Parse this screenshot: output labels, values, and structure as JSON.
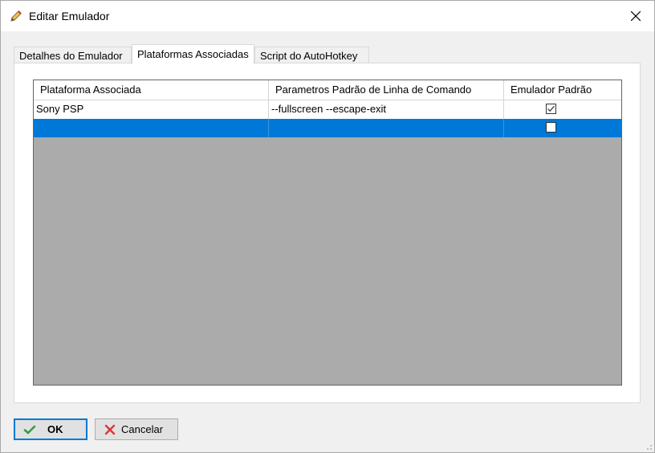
{
  "window": {
    "title": "Editar Emulador"
  },
  "tabs": [
    {
      "label": "Detalhes do Emulador"
    },
    {
      "label": "Plataformas Associadas"
    },
    {
      "label": "Script do AutoHotkey"
    }
  ],
  "grid": {
    "columns": [
      "Plataforma Associada",
      "Parametros Padrão de Linha de Comando",
      "Emulador Padrão"
    ],
    "rows": [
      {
        "platform": "Sony PSP",
        "params": "--fullscreen --escape-exit",
        "default": true
      },
      {
        "platform": "",
        "params": "",
        "default": false
      }
    ]
  },
  "buttons": {
    "ok": "OK",
    "cancel": "Cancelar"
  },
  "colors": {
    "selection": "#0078d7",
    "grid_background": "#ababab",
    "ok_check": "#2ea043",
    "cancel_x": "#d9363e"
  }
}
